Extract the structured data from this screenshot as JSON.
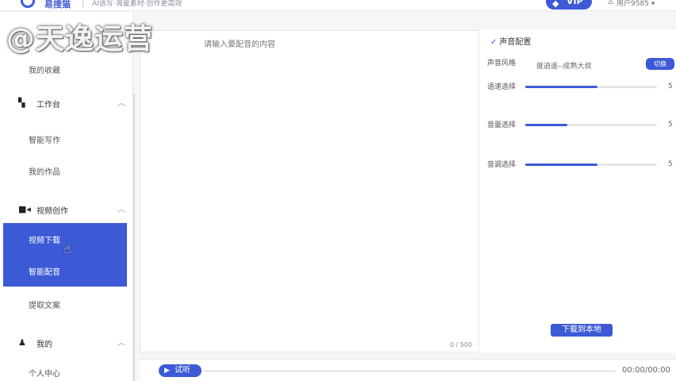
{
  "header": {
    "logo_text": "易搜猫",
    "slogan": "AI语写·海量素材·创作更高效",
    "vip_label": "VIP",
    "user_name": "用户9585 ▾"
  },
  "watermark": "@天逸运营",
  "sidebar": {
    "item_collection": "我的收藏",
    "group_workbench": "工作台",
    "item_smart_write": "智能写作",
    "item_my_works": "我的作品",
    "group_video": "视频创作",
    "item_video_download": "视频下载",
    "item_smart_dub": "智能配音",
    "item_extract_text": "提取文案",
    "group_mine": "我的",
    "item_profile": "个人中心"
  },
  "editor": {
    "placeholder": "请输入要配音的内容",
    "char_count": "0 / 500"
  },
  "voice_settings": {
    "title": "声音配置",
    "style_label": "声音风格",
    "style_value": "度逍遥--成熟大叔",
    "switch_label": "切换",
    "speed_label": "语速选择",
    "speed_value": "5",
    "speed_fill": 0.55,
    "volume_label": "音量选择",
    "volume_value": "5",
    "volume_fill": 0.32,
    "pitch_label": "音调选择",
    "pitch_value": "5",
    "pitch_fill": 0.55,
    "download_label": "下载到本地"
  },
  "player": {
    "play_label": "试听",
    "time": "00:00/00:00"
  },
  "colors": {
    "accent": "#3d5ad6"
  }
}
